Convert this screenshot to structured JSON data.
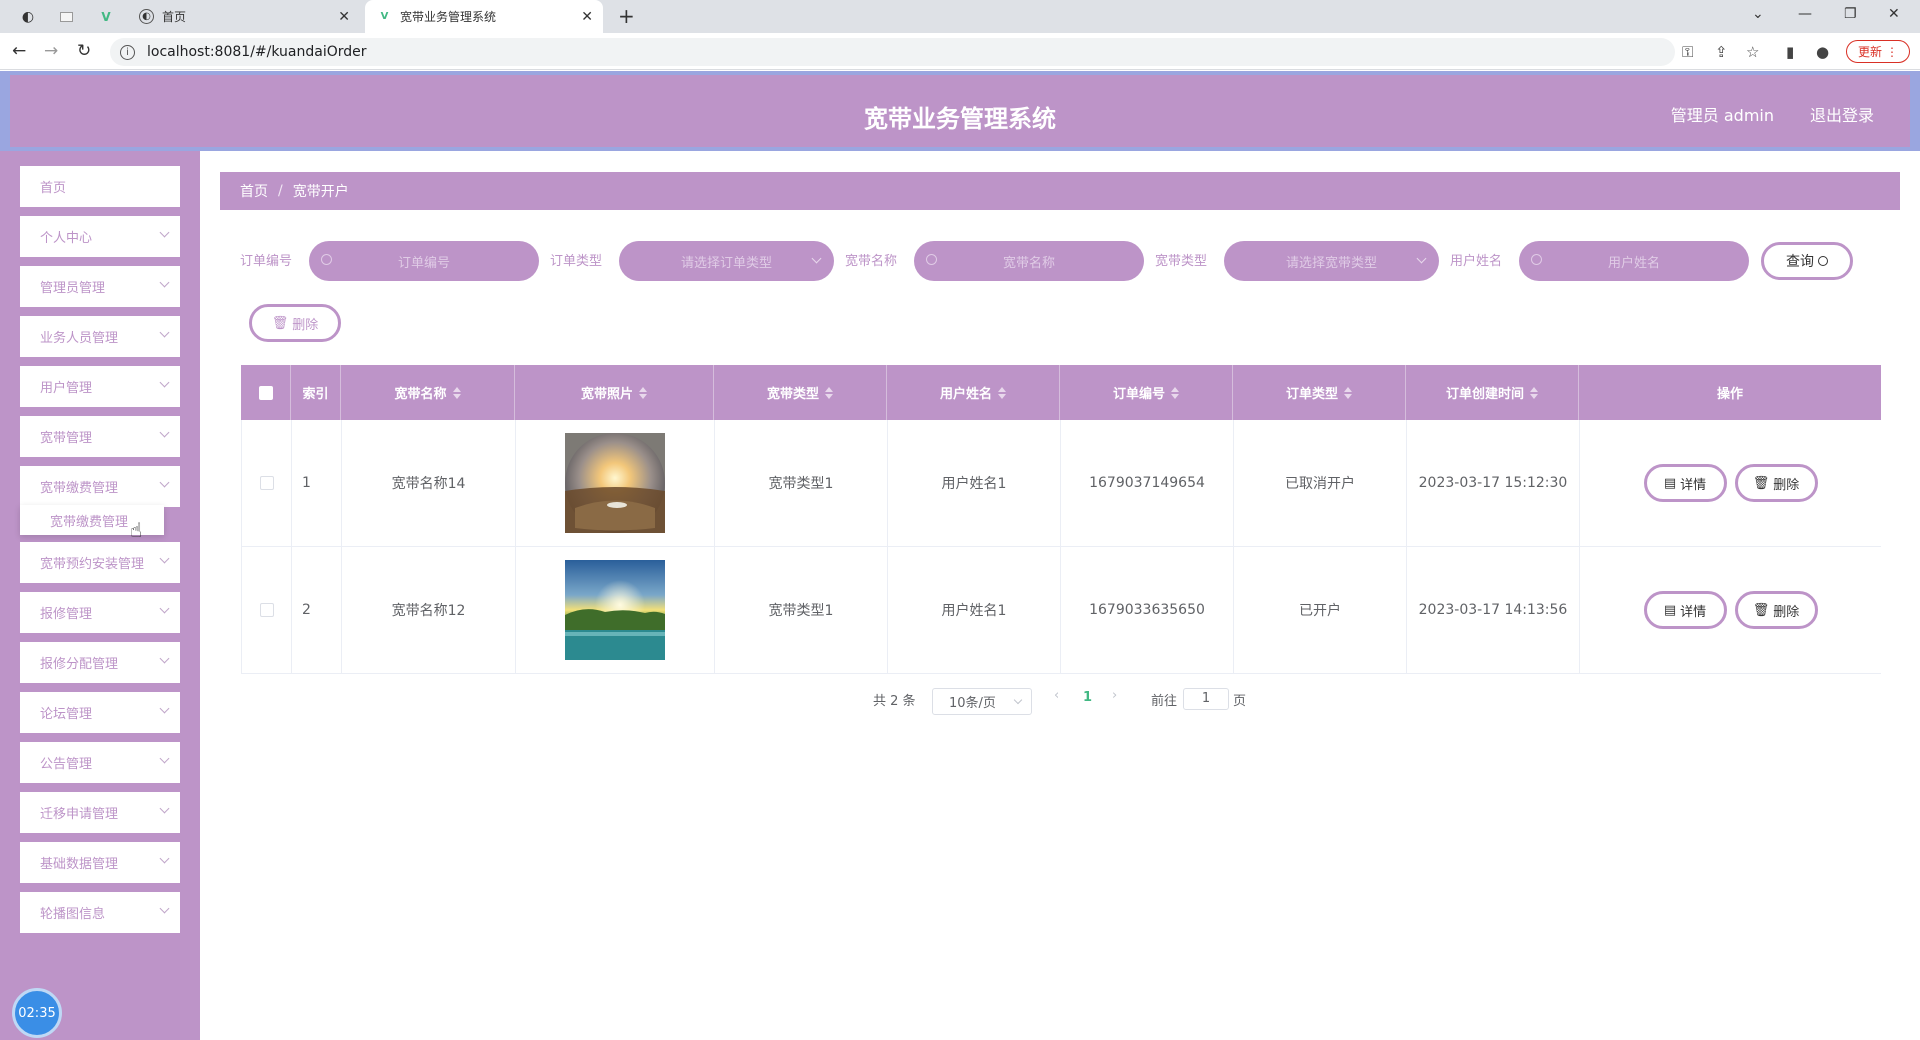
{
  "browser": {
    "tabs": [
      {
        "label": "首页"
      },
      {
        "label": "宽带业务管理系统"
      }
    ],
    "url": "localhost:8081/#/kuandaiOrder",
    "update_label": "更新"
  },
  "header": {
    "title": "宽带业务管理系统",
    "user": "管理员 admin",
    "logout": "退出登录"
  },
  "sidebar": {
    "items": [
      {
        "label": "首页"
      },
      {
        "label": "个人中心"
      },
      {
        "label": "管理员管理"
      },
      {
        "label": "业务人员管理"
      },
      {
        "label": "用户管理"
      },
      {
        "label": "宽带管理"
      },
      {
        "label": "宽带缴费管理"
      },
      {
        "label": "宽带预约安装管理"
      },
      {
        "label": "报修管理"
      },
      {
        "label": "报修分配管理"
      },
      {
        "label": "论坛管理"
      },
      {
        "label": "公告管理"
      },
      {
        "label": "迁移申请管理"
      },
      {
        "label": "基础数据管理"
      },
      {
        "label": "轮播图信息"
      }
    ],
    "submenu": "宽带缴费管理",
    "clock": "02:35"
  },
  "breadcrumb": {
    "home": "首页",
    "current": "宽带开户"
  },
  "filters": {
    "order_no_label": "订单编号",
    "order_no_placeholder": "订单编号",
    "order_type_label": "订单类型",
    "order_type_placeholder": "请选择订单类型",
    "kd_name_label": "宽带名称",
    "kd_name_placeholder": "宽带名称",
    "kd_type_label": "宽带类型",
    "kd_type_placeholder": "请选择宽带类型",
    "user_name_label": "用户姓名",
    "user_name_placeholder": "用户姓名",
    "query_label": "查询",
    "delete_label": "删除"
  },
  "table": {
    "headers": {
      "index": "索引",
      "name": "宽带名称",
      "photo": "宽带照片",
      "type": "宽带类型",
      "user": "用户姓名",
      "order_no": "订单编号",
      "order_type": "订单类型",
      "created": "订单创建时间",
      "ops": "操作"
    },
    "rows": [
      {
        "index": "1",
        "name": "宽带名称14",
        "photo": "sunset-desert-photo",
        "type": "宽带类型1",
        "user": "用户姓名1",
        "order_no": "1679037149654",
        "order_type": "已取消开户",
        "created": "2023-03-17 15:12:30"
      },
      {
        "index": "2",
        "name": "宽带名称12",
        "photo": "lake-sunrise-photo",
        "type": "宽带类型1",
        "user": "用户姓名1",
        "order_no": "1679033635650",
        "order_type": "已开户",
        "created": "2023-03-17 14:13:56"
      }
    ],
    "detail_label": "详情",
    "delete_label": "删除"
  },
  "pagination": {
    "total": "共 2 条",
    "page_size": "10条/页",
    "current": "1",
    "goto_label": "前往",
    "goto_value": "1",
    "page_suffix": "页"
  },
  "colors": {
    "theme": "#bd94c8",
    "header_border": "#9aa6e0"
  }
}
